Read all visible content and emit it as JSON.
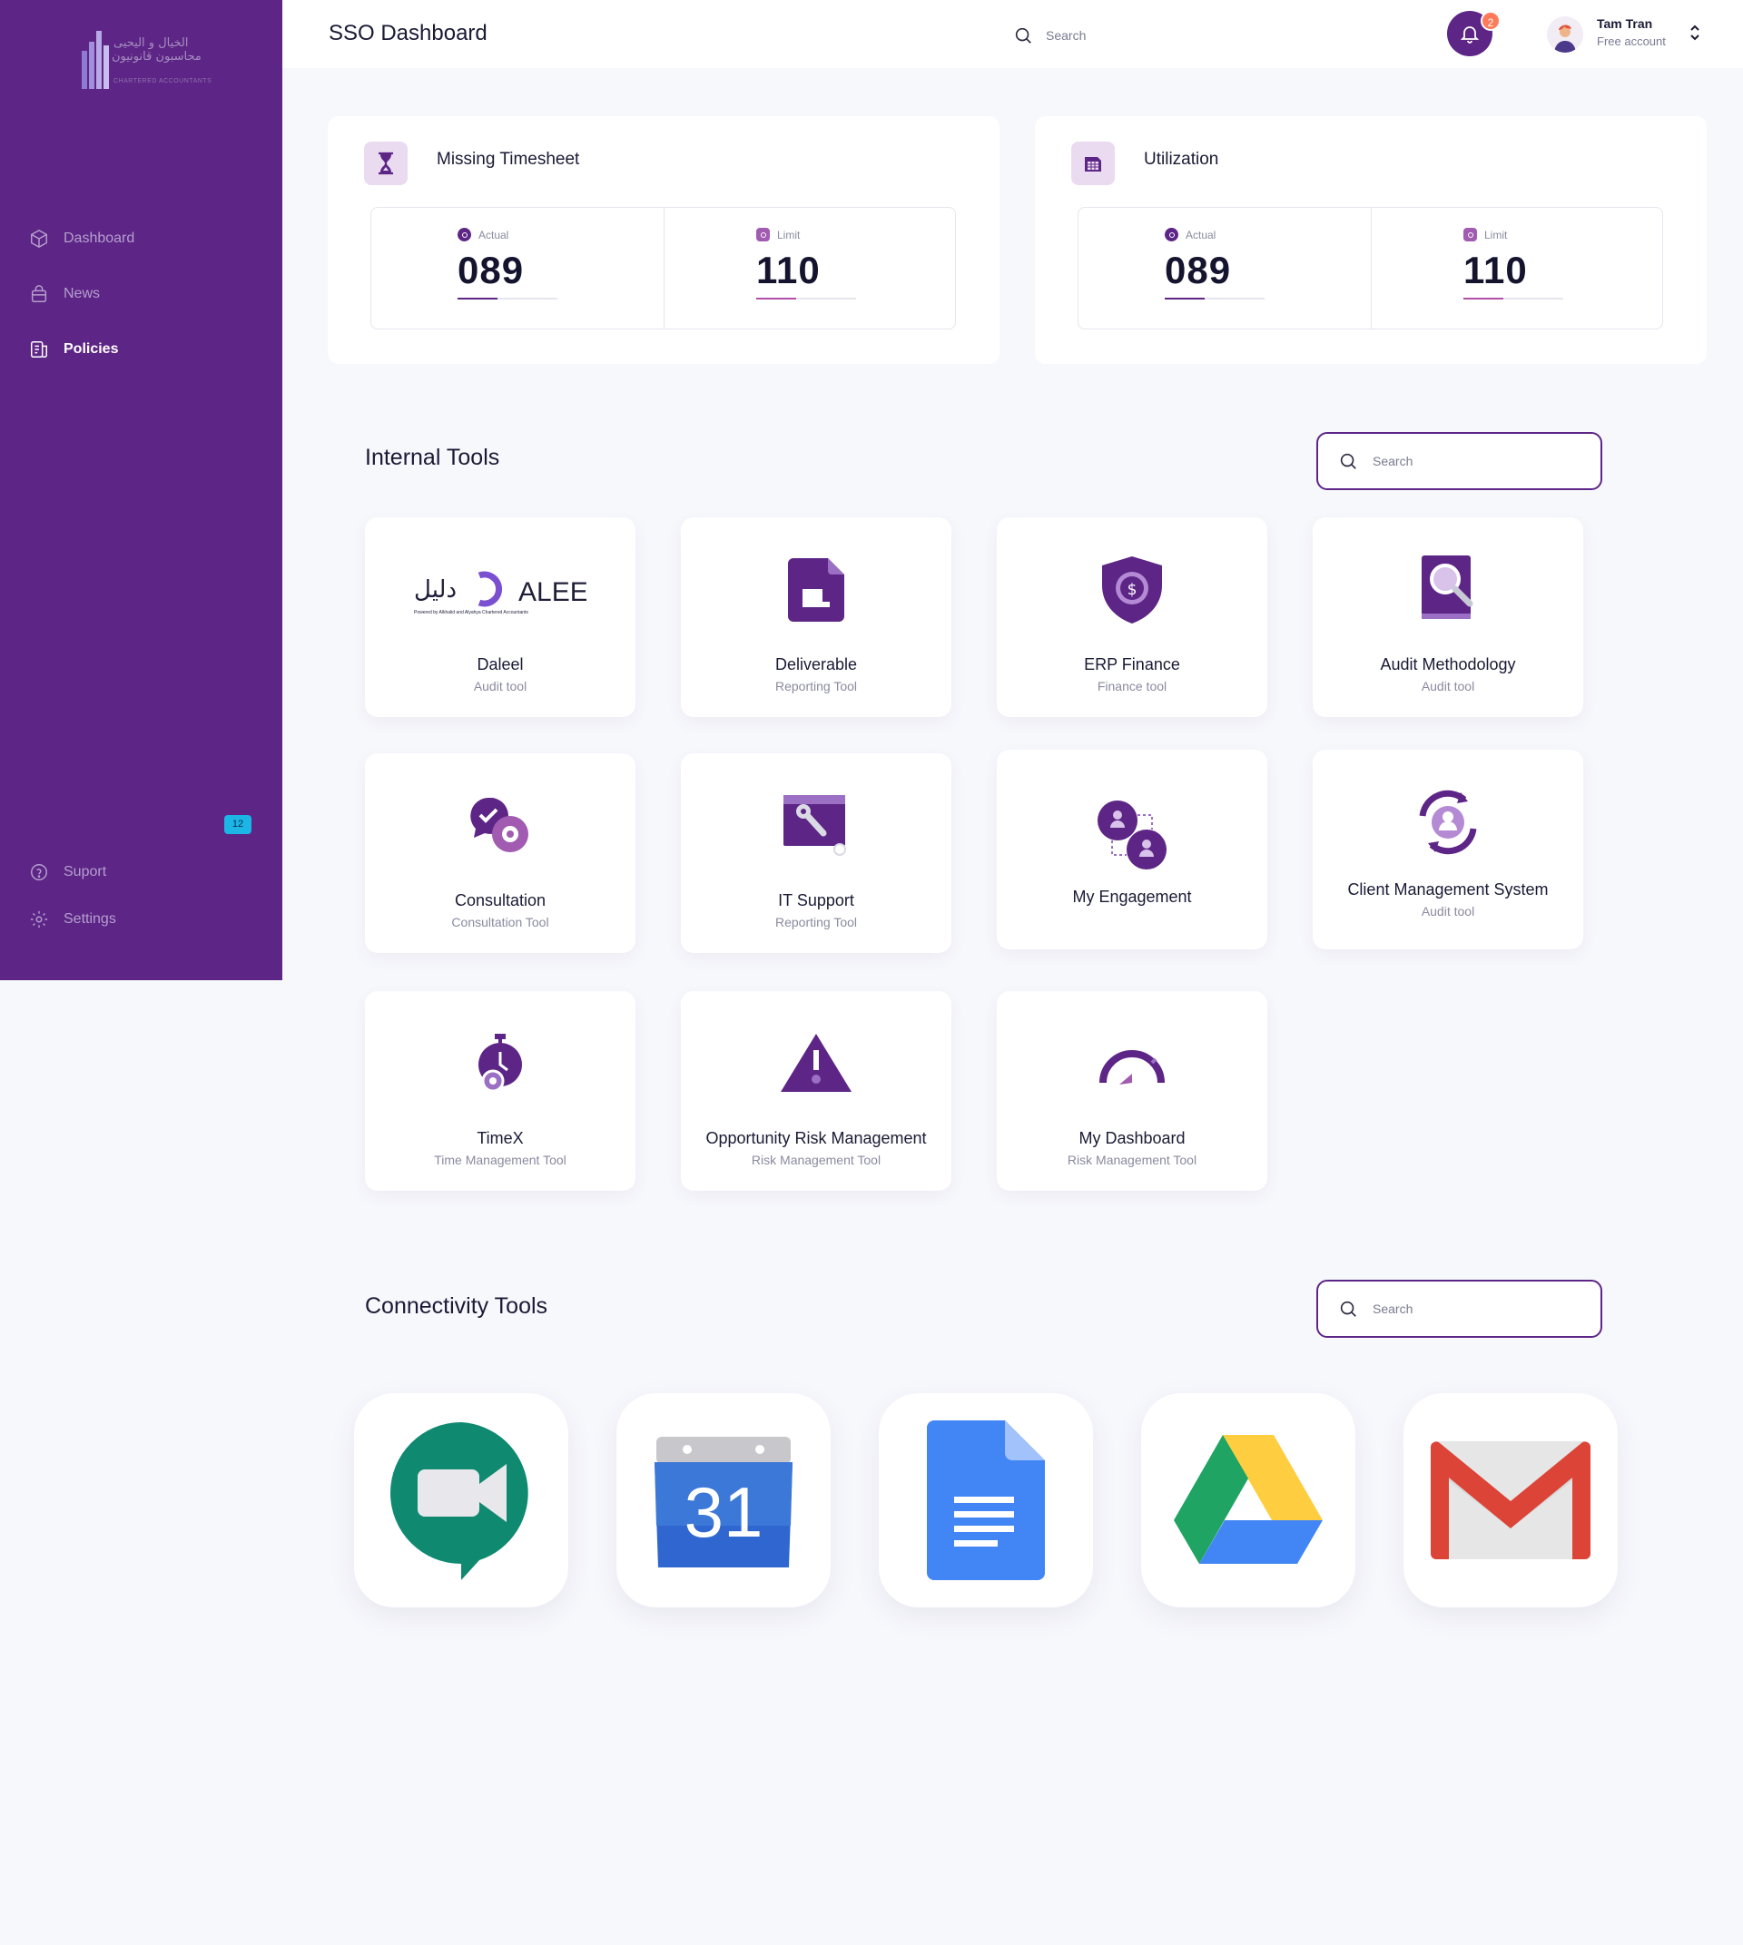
{
  "header": {
    "title": "SSO Dashboard",
    "search_placeholder": "Search",
    "notification_count": "2",
    "user": {
      "name": "Tam Tran",
      "plan": "Free account"
    }
  },
  "logo": {
    "arabic_line1": "الخيال و اليحيى",
    "arabic_line2": "محاسبون قانونيون",
    "english": "CHARTERED ACCOUNTANTS"
  },
  "sidebar": {
    "items": [
      {
        "label": "Dashboard",
        "icon": "cube-icon",
        "active": false
      },
      {
        "label": "News",
        "icon": "bag-icon",
        "active": false
      },
      {
        "label": "Policies",
        "icon": "document-icon",
        "active": true
      }
    ],
    "badge": "12",
    "bottom": [
      {
        "label": "Suport",
        "icon": "help-icon"
      },
      {
        "label": "Settings",
        "icon": "gear-icon"
      }
    ]
  },
  "stats": [
    {
      "title": "Missing Timesheet",
      "icon": "hourglass-icon",
      "actual": {
        "label": "Actual",
        "value": "089",
        "progress": 0.4
      },
      "limit": {
        "label": "Limit",
        "value": "110",
        "progress": 0.4
      }
    },
    {
      "title": "Utilization",
      "icon": "calendar-grid-icon",
      "actual": {
        "label": "Actual",
        "value": "089",
        "progress": 0.4
      },
      "limit": {
        "label": "Limit",
        "value": "110",
        "progress": 0.4
      }
    }
  ],
  "internal_tools": {
    "title": "Internal Tools",
    "search_placeholder": "Search",
    "daleel_logo": {
      "text": "ALEEL",
      "arabic": "دليل",
      "tagline": "Powered by Alkhalid and Alyahya Chartered Accountants"
    },
    "tools": [
      {
        "name": "Daleel",
        "sub": "Audit tool",
        "icon": "daleel-logo"
      },
      {
        "name": "Deliverable",
        "sub": "Reporting Tool",
        "icon": "file-icon"
      },
      {
        "name": "ERP Finance",
        "sub": "Finance tool",
        "icon": "shield-dollar-icon"
      },
      {
        "name": "Audit Methodology",
        "sub": "Audit tool",
        "icon": "book-search-icon"
      },
      {
        "name": "Consultation",
        "sub": "Consultation Tool",
        "icon": "chat-gear-icon"
      },
      {
        "name": "IT Support",
        "sub": "Reporting Tool",
        "icon": "wrench-window-icon"
      },
      {
        "name": "My Engagement",
        "sub": "",
        "icon": "people-link-icon"
      },
      {
        "name": "Client Management System",
        "sub": "Audit tool",
        "icon": "user-cycle-icon"
      },
      {
        "name": "TimeX",
        "sub": "Time Management Tool",
        "icon": "stopwatch-gear-icon"
      },
      {
        "name": "Opportunity Risk Management",
        "sub": "Risk Management Tool",
        "icon": "warning-triangle-icon"
      },
      {
        "name": "My Dashboard",
        "sub": "Risk Management Tool",
        "icon": "gauge-icon"
      }
    ]
  },
  "connectivity_tools": {
    "title": "Connectivity Tools",
    "search_placeholder": "Search",
    "calendar_day": "31",
    "apps": [
      {
        "icon": "google-meet-icon"
      },
      {
        "icon": "google-calendar-icon"
      },
      {
        "icon": "google-docs-icon"
      },
      {
        "icon": "google-drive-icon"
      },
      {
        "icon": "gmail-icon"
      }
    ]
  },
  "colors": {
    "primary": "#5d2586",
    "accent": "#ff7a59",
    "badge": "#1bb5e6",
    "background": "#f7f8fc"
  }
}
